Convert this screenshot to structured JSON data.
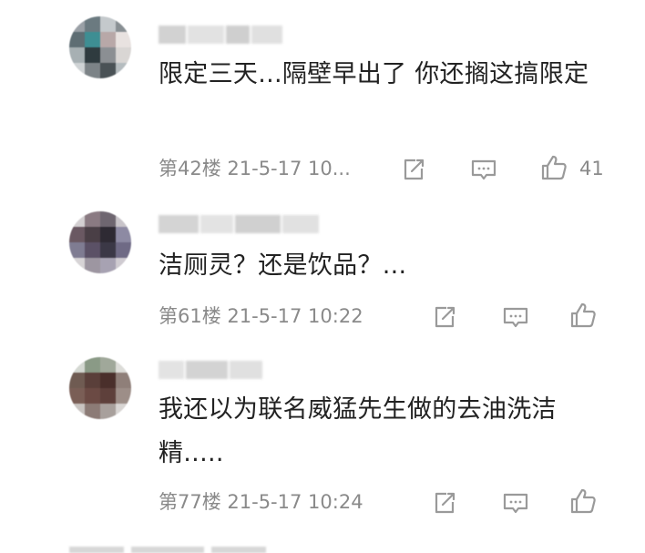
{
  "comments": [
    {
      "text": "限定三天...隔壁早出了 你还搁这搞限定",
      "floor_time": "第42楼 21-5-17 10...",
      "likes": "41",
      "avatar_colors": [
        "#9aa0a6",
        "#6b7a80",
        "#c4c9cc",
        "#888f93",
        "#5e6d73",
        "#3e8e93",
        "#b8a8a8",
        "#e8e2e0",
        "#a7b0b3",
        "#2f3b3f",
        "#8b8f93",
        "#d9d6d4",
        "#cfd3d5",
        "#7c8387",
        "#4a5256",
        "#b5bcbf"
      ]
    },
    {
      "text": "洁厕灵？还是饮品？...",
      "floor_time": "第61楼 21-5-17 10:22",
      "likes": "",
      "avatar_colors": [
        "#d3cfd1",
        "#8a7a82",
        "#6e6670",
        "#c8c4c9",
        "#6a5862",
        "#4a3f46",
        "#2e2a33",
        "#8d8aa3",
        "#7f7c92",
        "#5b5166",
        "#3b3846",
        "#6f6a85",
        "#d7d4d6",
        "#9d96a1",
        "#a7a2b2",
        "#cfcbd1"
      ]
    },
    {
      "text": "我还以为联名威猛先生做的去油洗洁精.....",
      "floor_time": "第77楼 21-5-17 10:24",
      "likes": "",
      "avatar_colors": [
        "#d4d8d2",
        "#8a9a86",
        "#a0a89a",
        "#dcdcd8",
        "#6f5b52",
        "#5a3f3a",
        "#4a2f2b",
        "#8f7f79",
        "#7a5e56",
        "#6b4a44",
        "#5e403b",
        "#9d8e88",
        "#c9c4c1",
        "#8c7b76",
        "#a8a09c",
        "#d8d5d3"
      ]
    }
  ],
  "colors": {
    "text": "#222222",
    "meta": "#8a8a8a",
    "icon": "#9a9a9a",
    "background": "#ffffff"
  },
  "icons": {
    "share": "share-icon",
    "reply": "reply-icon",
    "like": "thumbs-up-icon"
  }
}
